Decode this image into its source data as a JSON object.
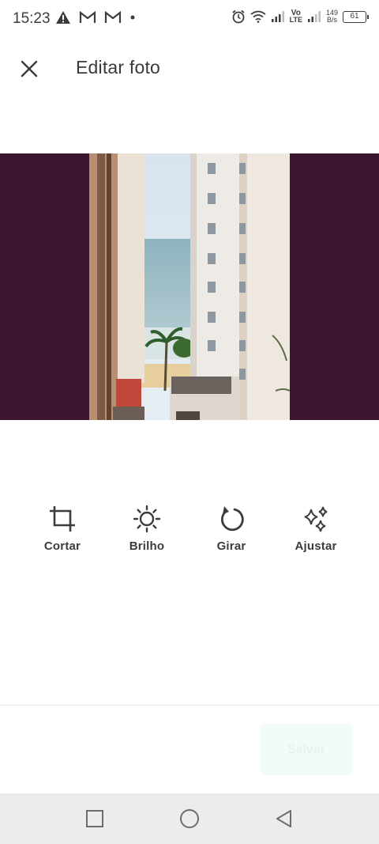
{
  "status_bar": {
    "time": "15:23",
    "net_top": "Vo",
    "net_bottom": "LTE",
    "speed_value": "149",
    "speed_unit": "B/s",
    "battery": "61"
  },
  "header": {
    "title": "Editar foto",
    "close_icon": "close-icon"
  },
  "tools": [
    {
      "label": "Cortar",
      "icon": "crop-icon"
    },
    {
      "label": "Brilho",
      "icon": "brightness-icon"
    },
    {
      "label": "Girar",
      "icon": "rotate-icon"
    },
    {
      "label": "Ajustar",
      "icon": "sparkles-icon"
    }
  ],
  "footer": {
    "save_label": "Salvar"
  },
  "colors": {
    "photo_background": "#3a1630",
    "save_button_bg": "#f3fbfa",
    "save_button_text": "#e4f2f0",
    "navbar_bg": "#ececec"
  }
}
